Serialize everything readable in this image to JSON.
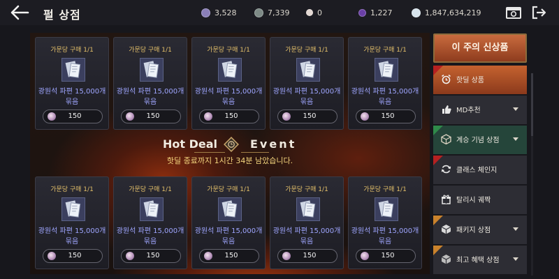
{
  "header": {
    "title": "펄 상점",
    "currencies": [
      {
        "icon": "purple-orb-currency-icon",
        "value": "3,528",
        "color": "#8a7fb8"
      },
      {
        "icon": "grey-orb-currency-icon",
        "value": "7,339",
        "color": "#7d8a86"
      },
      {
        "icon": "pearl-currency-icon",
        "value": "0",
        "color": "#e3d8d2"
      },
      {
        "icon": "violet-gem-currency-icon",
        "value": "1,227",
        "color": "#6a3fa6"
      },
      {
        "icon": "white-pearl-currency-icon",
        "value": "1,847,634,219",
        "color": "#d7e3ec"
      }
    ]
  },
  "product": {
    "limit": "가문당 구매 1/1",
    "name_line1": "광원석 파편 15,000개",
    "name_line2": "묶음",
    "price": "150"
  },
  "banner": {
    "title_left": "Hot Deal",
    "title_right": "Event",
    "subtitle": "핫딜 종료까지 1시간 34분 남았습니다."
  },
  "sidebar": {
    "featured": "이 주의 신상품",
    "items": [
      {
        "label": "핫딜 상품",
        "icon": "alarm-clock-icon",
        "tag": "HOT",
        "active": true
      },
      {
        "label": "MD추천",
        "icon": "thumbs-up-icon",
        "dropdown": true
      },
      {
        "label": "계승 기념 상점",
        "icon": "cube-icon",
        "tag": "NEW",
        "dropdown": true
      },
      {
        "label": "클래스 체인지",
        "icon": "refresh-icon",
        "tag": "HOT"
      },
      {
        "label": "탈리시 궤짝",
        "icon": "gift-box-icon"
      },
      {
        "label": "패키지 상점",
        "icon": "package-icon",
        "tag": "SALE",
        "dropdown": true
      },
      {
        "label": "최고 혜택 상점",
        "icon": "box-icon",
        "tag": "SALE",
        "dropdown": true
      }
    ]
  },
  "colors": {
    "accent_gold": "#e4c06a",
    "item_name": "#9fa6ff",
    "deal_text": "#f5d67e",
    "active_tab": "#8e3c1e"
  }
}
